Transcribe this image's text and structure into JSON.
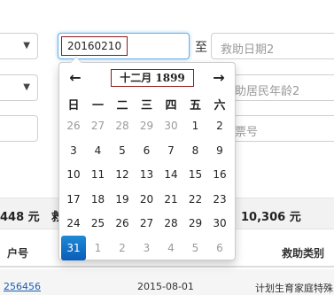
{
  "form": {
    "row1": {
      "date_from_value": "20160210",
      "range_separator": "至",
      "date_to_placeholder": "救助日期2"
    },
    "row2": {
      "age_placeholder": "助居民年龄2"
    },
    "row3": {
      "field_placeholder": "票号"
    }
  },
  "summary": {
    "left_amount": "448 元",
    "left_label_partial": "救",
    "right_amount": "10,306 元"
  },
  "table": {
    "headers": {
      "account": "户号",
      "category": "救助类别"
    },
    "rows": [
      {
        "account": "256456",
        "date": "2015-08-01",
        "category": "计划生育家庭特殊"
      }
    ]
  },
  "datepicker": {
    "prev_icon": "←",
    "next_icon": "→",
    "title": "十二月 1899",
    "weekdays": [
      "日",
      "一",
      "二",
      "三",
      "四",
      "五",
      "六"
    ],
    "weeks": [
      [
        {
          "d": "26",
          "t": "old"
        },
        {
          "d": "27",
          "t": "old"
        },
        {
          "d": "28",
          "t": "old"
        },
        {
          "d": "29",
          "t": "old"
        },
        {
          "d": "30",
          "t": "old"
        },
        {
          "d": "1",
          "t": "cur"
        },
        {
          "d": "2",
          "t": "cur"
        }
      ],
      [
        {
          "d": "3",
          "t": "cur"
        },
        {
          "d": "4",
          "t": "cur"
        },
        {
          "d": "5",
          "t": "cur"
        },
        {
          "d": "6",
          "t": "cur"
        },
        {
          "d": "7",
          "t": "cur"
        },
        {
          "d": "8",
          "t": "cur"
        },
        {
          "d": "9",
          "t": "cur"
        }
      ],
      [
        {
          "d": "10",
          "t": "cur"
        },
        {
          "d": "11",
          "t": "cur"
        },
        {
          "d": "12",
          "t": "cur"
        },
        {
          "d": "13",
          "t": "cur"
        },
        {
          "d": "14",
          "t": "cur"
        },
        {
          "d": "15",
          "t": "cur"
        },
        {
          "d": "16",
          "t": "cur"
        }
      ],
      [
        {
          "d": "17",
          "t": "cur"
        },
        {
          "d": "18",
          "t": "cur"
        },
        {
          "d": "19",
          "t": "cur"
        },
        {
          "d": "20",
          "t": "cur"
        },
        {
          "d": "21",
          "t": "cur"
        },
        {
          "d": "22",
          "t": "cur"
        },
        {
          "d": "23",
          "t": "cur"
        }
      ],
      [
        {
          "d": "24",
          "t": "cur"
        },
        {
          "d": "25",
          "t": "cur"
        },
        {
          "d": "26",
          "t": "cur"
        },
        {
          "d": "27",
          "t": "cur"
        },
        {
          "d": "28",
          "t": "cur"
        },
        {
          "d": "29",
          "t": "cur"
        },
        {
          "d": "30",
          "t": "cur"
        }
      ],
      [
        {
          "d": "31",
          "t": "active"
        },
        {
          "d": "1",
          "t": "new"
        },
        {
          "d": "2",
          "t": "new"
        },
        {
          "d": "3",
          "t": "new"
        },
        {
          "d": "4",
          "t": "new"
        },
        {
          "d": "5",
          "t": "new"
        },
        {
          "d": "6",
          "t": "new"
        }
      ]
    ],
    "active_color": "#0a5cb8"
  },
  "icons": {
    "dropdown": "chevron-down-icon"
  }
}
